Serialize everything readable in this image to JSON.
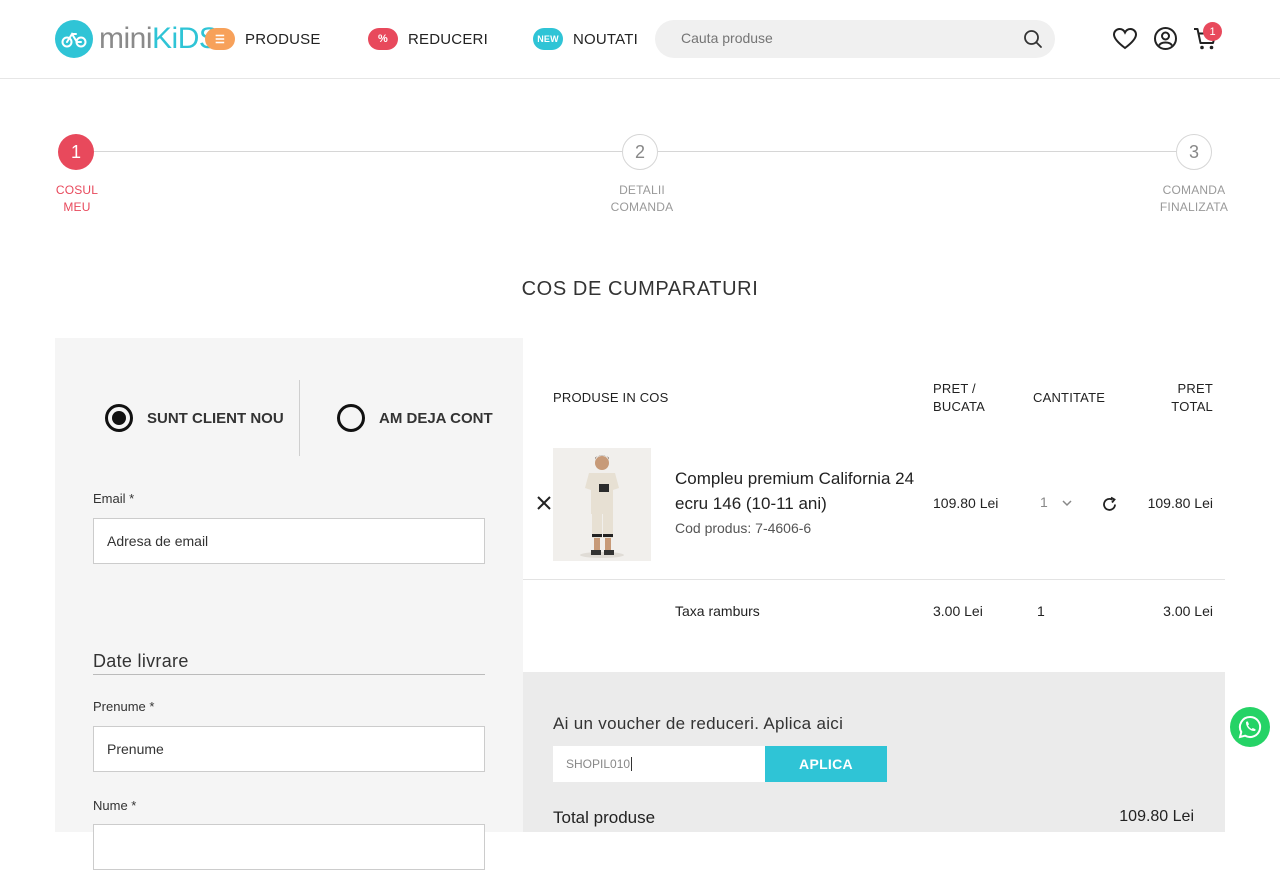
{
  "brand": {
    "logo_mini": "mini",
    "logo_kids": "KiDS"
  },
  "nav": [
    {
      "label": "PRODUSE",
      "badge": "☰",
      "color": "#f7a15a"
    },
    {
      "label": "REDUCERI",
      "badge": "%",
      "color": "#e8495c"
    },
    {
      "label": "NOUTATI",
      "badge": "NEW",
      "color": "#2fc4d6"
    }
  ],
  "search": {
    "placeholder": "Cauta produse"
  },
  "cart": {
    "count": "1"
  },
  "steps": [
    {
      "number": "1",
      "label_line1": "COSUL",
      "label_line2": "MEU",
      "active": true
    },
    {
      "number": "2",
      "label_line1": "DETALII",
      "label_line2": "COMANDA",
      "active": false
    },
    {
      "number": "3",
      "label_line1": "COMANDA",
      "label_line2": "FINALIZATA",
      "active": false
    }
  ],
  "page_title": "COS DE CUMPARATURI",
  "account": {
    "option_new": "SUNT CLIENT NOU",
    "option_existing": "AM DEJA CONT",
    "selected": "new"
  },
  "form": {
    "email_label": "Email *",
    "email_placeholder": "Adresa de email",
    "delivery_title": "Date livrare",
    "firstname_label": "Prenume *",
    "firstname_placeholder": "Prenume",
    "lastname_label": "Nume *"
  },
  "table": {
    "col_products": "PRODUSE IN COS",
    "col_unit_price_1": "PRET /",
    "col_unit_price_2": "BUCATA",
    "col_quantity": "CANTITATE",
    "col_total_1": "PRET",
    "col_total_2": "TOTAL"
  },
  "items": [
    {
      "name": "Compleu premium California 24 ecru 146 (10-11 ani)",
      "code": "Cod produs: 7-4606-6",
      "unit_price": "109.80 Lei",
      "quantity": "1",
      "total": "109.80 Lei"
    }
  ],
  "fee": {
    "name": "Taxa ramburs",
    "unit_price": "3.00 Lei",
    "quantity": "1",
    "total": "3.00 Lei"
  },
  "voucher": {
    "title": "Ai un voucher de reduceri. Aplica aici",
    "value": "SHOPIL010",
    "button": "APLICA"
  },
  "totals": {
    "products_label": "Total produse",
    "products_value": "109.80 Lei"
  },
  "colors": {
    "accent": "#2fc4d6",
    "active": "#e8495c",
    "whatsapp": "#25d366"
  }
}
